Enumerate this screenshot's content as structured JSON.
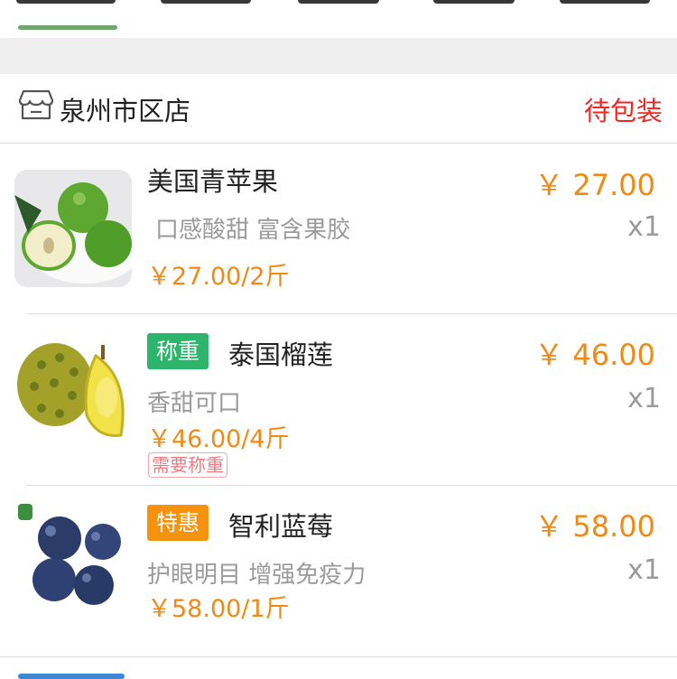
{
  "colors": {
    "accent_green": "#6fa86a",
    "price_orange": "#f08a15",
    "status_red": "#f0271f",
    "tag_green": "#2db56b",
    "tag_orange": "#f5930e"
  },
  "shop": {
    "icon": "store-icon",
    "name": "泉州市区店",
    "status": "待包装"
  },
  "items": [
    {
      "name": "美国青苹果",
      "desc": "口感酸甜 富含果胶",
      "unit_price": "￥27.00/2斤",
      "price": "￥ 27.00",
      "qty": "x1",
      "image": "green-apple-image"
    },
    {
      "tag": "称重",
      "name": "泰国榴莲",
      "desc": "香甜可口",
      "unit_price": "￥46.00/4斤",
      "price": "￥ 46.00",
      "qty": "x1",
      "note": "需要称重",
      "image": "durian-image"
    },
    {
      "tag": "特惠",
      "name": "智利蓝莓",
      "desc": "护眼明目 增强免疫力",
      "unit_price": "￥58.00/1斤",
      "price": "￥ 58.00",
      "qty": "x1",
      "image": "blueberry-image"
    }
  ]
}
